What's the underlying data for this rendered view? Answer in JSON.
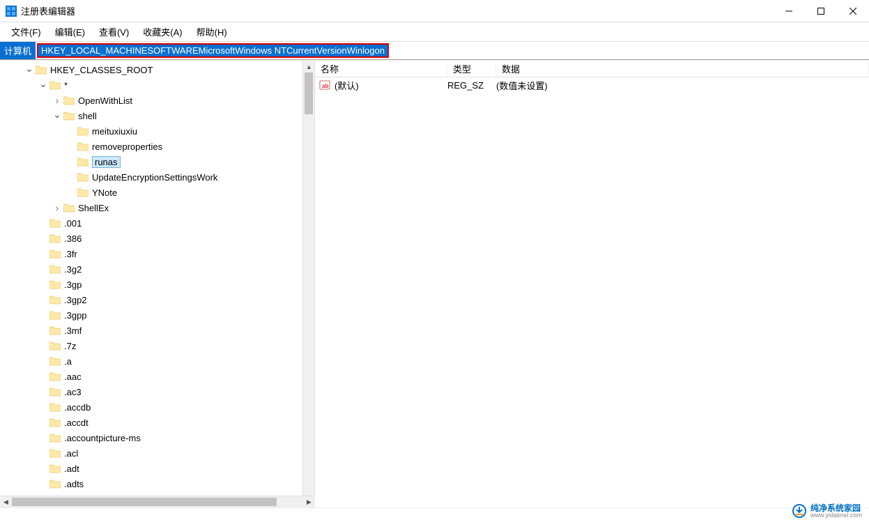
{
  "window": {
    "title": "注册表编辑器"
  },
  "menu": {
    "file": "文件(F)",
    "edit": "编辑(E)",
    "view": "查看(V)",
    "favorites": "收藏夹(A)",
    "help": "帮助(H)"
  },
  "address": {
    "prefix": "计算机",
    "path": "HKEY_LOCAL_MACHINESOFTWAREMicrosoftWindows NTCurrentVersionWinlogon"
  },
  "tree": [
    {
      "indent": 0,
      "expander": "v",
      "label": "HKEY_CLASSES_ROOT",
      "selected": false
    },
    {
      "indent": 1,
      "expander": "v",
      "label": "*",
      "selected": false
    },
    {
      "indent": 2,
      "expander": ">",
      "label": "OpenWithList",
      "selected": false
    },
    {
      "indent": 2,
      "expander": "v",
      "label": "shell",
      "selected": false
    },
    {
      "indent": 3,
      "expander": "",
      "label": "meituxiuxiu",
      "selected": false
    },
    {
      "indent": 3,
      "expander": "",
      "label": "removeproperties",
      "selected": false
    },
    {
      "indent": 3,
      "expander": "",
      "label": "runas",
      "selected": true
    },
    {
      "indent": 3,
      "expander": "",
      "label": "UpdateEncryptionSettingsWork",
      "selected": false
    },
    {
      "indent": 3,
      "expander": "",
      "label": "YNote",
      "selected": false
    },
    {
      "indent": 2,
      "expander": ">",
      "label": "ShellEx",
      "selected": false
    },
    {
      "indent": 1,
      "expander": "",
      "label": ".001",
      "selected": false
    },
    {
      "indent": 1,
      "expander": "",
      "label": ".386",
      "selected": false
    },
    {
      "indent": 1,
      "expander": "",
      "label": ".3fr",
      "selected": false
    },
    {
      "indent": 1,
      "expander": "",
      "label": ".3g2",
      "selected": false
    },
    {
      "indent": 1,
      "expander": "",
      "label": ".3gp",
      "selected": false
    },
    {
      "indent": 1,
      "expander": "",
      "label": ".3gp2",
      "selected": false
    },
    {
      "indent": 1,
      "expander": "",
      "label": ".3gpp",
      "selected": false
    },
    {
      "indent": 1,
      "expander": "",
      "label": ".3mf",
      "selected": false
    },
    {
      "indent": 1,
      "expander": "",
      "label": ".7z",
      "selected": false
    },
    {
      "indent": 1,
      "expander": "",
      "label": ".a",
      "selected": false
    },
    {
      "indent": 1,
      "expander": "",
      "label": ".aac",
      "selected": false
    },
    {
      "indent": 1,
      "expander": "",
      "label": ".ac3",
      "selected": false
    },
    {
      "indent": 1,
      "expander": "",
      "label": ".accdb",
      "selected": false
    },
    {
      "indent": 1,
      "expander": "",
      "label": ".accdt",
      "selected": false
    },
    {
      "indent": 1,
      "expander": "",
      "label": ".accountpicture-ms",
      "selected": false
    },
    {
      "indent": 1,
      "expander": "",
      "label": ".acl",
      "selected": false
    },
    {
      "indent": 1,
      "expander": "",
      "label": ".adt",
      "selected": false
    },
    {
      "indent": 1,
      "expander": "",
      "label": ".adts",
      "selected": false
    }
  ],
  "list": {
    "headers": {
      "name": "名称",
      "type": "类型",
      "data": "数据"
    },
    "rows": [
      {
        "name": "(默认)",
        "type": "REG_SZ",
        "data": "(数值未设置)"
      }
    ]
  },
  "watermark": {
    "text": "纯净系统家园",
    "url": "www.yidaimei.com"
  }
}
